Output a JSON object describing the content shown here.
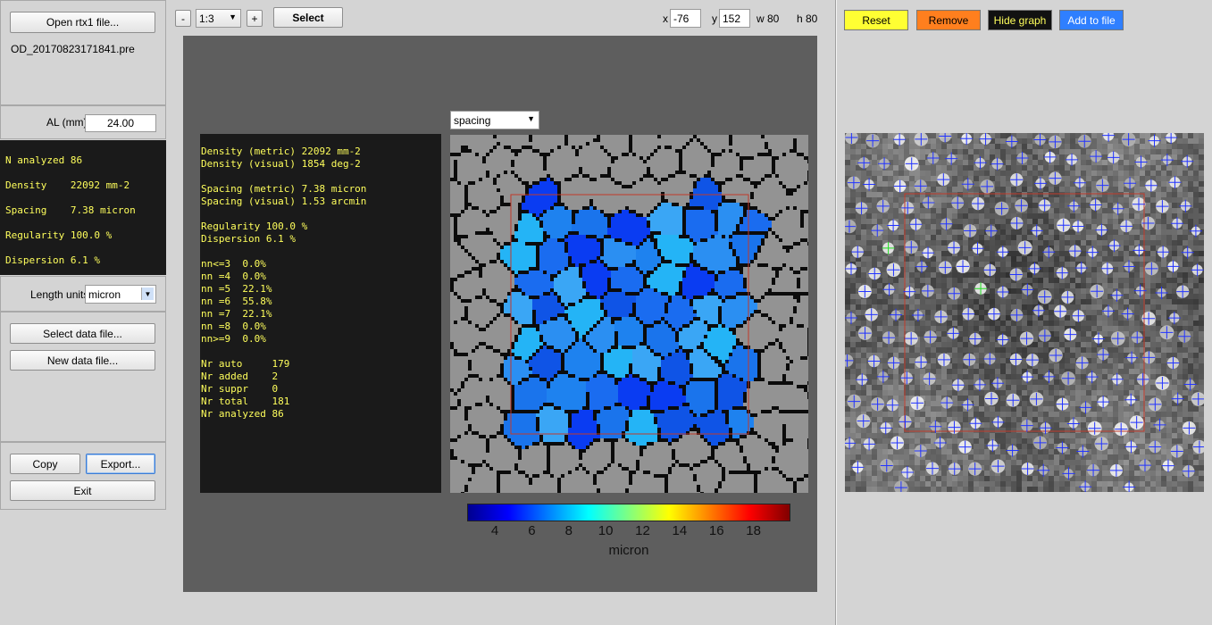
{
  "left": {
    "open_button": "Open rtx1 file...",
    "filename": "OD_20170823171841.pre",
    "al_label": "AL (mm)",
    "al_value": "24.00",
    "stats": {
      "n_analyzed": "N analyzed 86",
      "density": "Density    22092 mm-2",
      "spacing": "Spacing    7.38 micron",
      "regularity": "Regularity 100.0 %",
      "dispersion": "Dispersion 6.1 %"
    },
    "length_units_label": "Length units",
    "length_units_value": "micron",
    "select_data_button": "Select data file...",
    "new_data_button": "New data file...",
    "copy_button": "Copy",
    "export_button": "Export...",
    "exit_button": "Exit"
  },
  "toolbar": {
    "zoom_minus": "-",
    "zoom_value": "1:3",
    "zoom_plus": "+",
    "select_button": "Select",
    "x_label": "x",
    "x_value": "-76",
    "y_label": "y",
    "y_value": "152",
    "w_label": "w 80",
    "h_label": "h 80"
  },
  "report": {
    "lines": [
      "Density (metric) 22092 mm-2",
      "Density (visual) 1854 deg-2",
      "",
      "Spacing (metric) 7.38 micron",
      "Spacing (visual) 1.53 arcmin",
      "",
      "Regularity 100.0 %",
      "Dispersion 6.1 %",
      "",
      "nn<=3  0.0%",
      "nn =4  0.0%",
      "nn =5  22.1%",
      "nn =6  55.8%",
      "nn =7  22.1%",
      "nn =8  0.0%",
      "nn>=9  0.0%",
      "",
      "Nr auto     179",
      "Nr added    2",
      "Nr suppr    0",
      "Nr total    181",
      "Nr analyzed 86"
    ]
  },
  "map": {
    "metric_select": "spacing",
    "colorbar_ticks": [
      "4",
      "6",
      "8",
      "10",
      "12",
      "14",
      "16",
      "18"
    ],
    "colorbar_label": "micron"
  },
  "right": {
    "reset_button": "Reset",
    "remove_button": "Remove",
    "hide_graph_button": "Hide graph",
    "add_to_file_button": "Add to file"
  },
  "colors": {
    "reset": "#ffff33",
    "remove": "#ff7f1e",
    "hide_graph": "#111111",
    "add_to_file": "#2f7fff",
    "stats_text": "#ffff5c",
    "roi_box": "#c23a2a",
    "marker_blue": "#2233ff",
    "marker_green": "#22dd22"
  },
  "icons": {
    "dropdown": "chevron-down-icon",
    "marker": "crosshair-icon"
  }
}
